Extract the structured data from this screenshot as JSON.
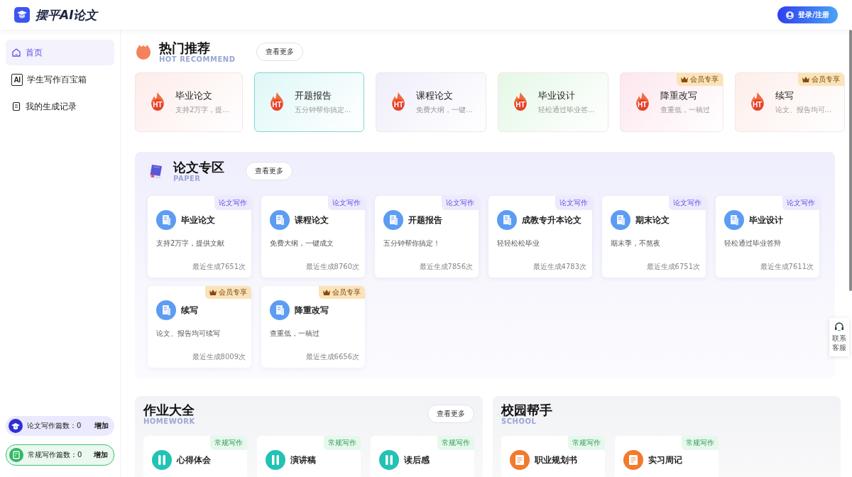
{
  "header": {
    "logo": "摆平AI论文",
    "login_button": "登录/注册"
  },
  "sidebar": {
    "items": [
      {
        "label": "首页",
        "kind": "home",
        "selected": true
      },
      {
        "label": "学生写作百宝箱",
        "kind": "ai",
        "icon_text": "AI",
        "selected": false
      },
      {
        "label": "我的生成记录",
        "kind": "record",
        "selected": false
      }
    ],
    "counters": [
      {
        "label": "论文写作篇数：0",
        "action": "增加",
        "kind": "paper"
      },
      {
        "label": "常规写作篇数：0",
        "action": "增加",
        "kind": "general"
      }
    ]
  },
  "hot": {
    "title": "热门推荐",
    "subtitle": "HOT RECOMMEND",
    "more": "查看更多",
    "cards": [
      {
        "icon_text": "HT",
        "title": "毕业论文",
        "desc": "支持2万字，提...",
        "color": "#fdecea"
      },
      {
        "icon_text": "HT",
        "title": "开题报告",
        "desc": "五分钟帮你搞定...",
        "color": "#dff7f7"
      },
      {
        "icon_text": "HT",
        "title": "课程论文",
        "desc": "免费大纲，一键...",
        "color": "#efeefb"
      },
      {
        "icon_text": "HT",
        "title": "毕业设计",
        "desc": "轻松通过毕业答...",
        "color": "#e4f8e6"
      },
      {
        "icon_text": "HT",
        "title": "降重改写",
        "desc": "查重低，一稿过",
        "color": "#fde6ef",
        "badge": "会员专享"
      },
      {
        "icon_text": "HT",
        "title": "续写",
        "desc": "论文、报告均可...",
        "color": "#fdeeea",
        "badge": "会员专享"
      }
    ]
  },
  "paper": {
    "title": "论文专区",
    "subtitle": "PAPER",
    "more": "查看更多",
    "cards": [
      {
        "title": "毕业论文",
        "desc": "支持2万字，提供文献",
        "count": "最近生成7651次",
        "badge": "论文写作",
        "kind": "tag"
      },
      {
        "title": "课程论文",
        "desc": "免费大纲，一键成文",
        "count": "最近生成8760次",
        "badge": "论文写作",
        "kind": "tag"
      },
      {
        "title": "开题报告",
        "desc": "五分钟帮你搞定！",
        "count": "最近生成7856次",
        "badge": "论文写作",
        "kind": "tag"
      },
      {
        "title": "成教专升本论文",
        "desc": "轻轻松松毕业",
        "count": "最近生成4783次",
        "badge": "论文写作",
        "kind": "tag"
      },
      {
        "title": "期末论文",
        "desc": "期末季，不熬夜",
        "count": "最近生成6751次",
        "badge": "论文写作",
        "kind": "tag"
      },
      {
        "title": "毕业设计",
        "desc": "轻松通过毕业答辩",
        "count": "最近生成7611次",
        "badge": "论文写作",
        "kind": "tag"
      },
      {
        "title": "续写",
        "desc": "论文、报告均可续写",
        "count": "最近生成8009次",
        "badge": "会员专享",
        "kind": "vip"
      },
      {
        "title": "降重改写",
        "desc": "查重低，一稿过",
        "count": "最近生成6656次",
        "badge": "会员专享",
        "kind": "vip"
      }
    ]
  },
  "sections": [
    {
      "title": "作业大全",
      "subtitle": "HOMEWORK",
      "more": "查看更多",
      "kind": "homework",
      "cards": [
        {
          "title": "心得体会",
          "badge": "常规写作"
        },
        {
          "title": "演讲稿",
          "badge": "常规写作"
        },
        {
          "title": "读后感",
          "badge": "常规写作"
        }
      ]
    },
    {
      "title": "校园帮手",
      "subtitle": "SCHOOL",
      "kind": "school",
      "cards": [
        {
          "title": "职业规划书",
          "badge": "常规写作"
        },
        {
          "title": "实习周记",
          "badge": "常规写作"
        }
      ]
    }
  ],
  "contact": "联系客服"
}
